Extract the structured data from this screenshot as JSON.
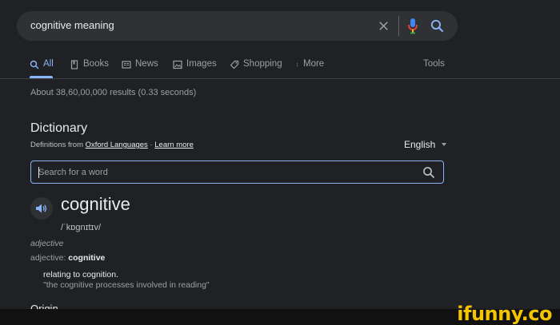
{
  "search": {
    "query": "cognitive meaning"
  },
  "tabs": [
    {
      "label": "All",
      "icon": "search-icon"
    },
    {
      "label": "Books",
      "icon": "book-icon"
    },
    {
      "label": "News",
      "icon": "news-icon"
    },
    {
      "label": "Images",
      "icon": "image-icon"
    },
    {
      "label": "Shopping",
      "icon": "tag-icon"
    },
    {
      "label": "More",
      "icon": "kebab-icon"
    }
  ],
  "tools_label": "Tools",
  "result_stats": "About 38,60,00,000 results (0.33 seconds)",
  "dictionary": {
    "title": "Dictionary",
    "defs_from_prefix": "Definitions from",
    "source": "Oxford Languages",
    "separator": "·",
    "learn_more": "Learn more",
    "language": "English",
    "search_placeholder": "Search for a word",
    "word": "cognitive",
    "phonetic": "/ˈkɒɡnɪtɪv/",
    "part_of_speech": "adjective",
    "pos_label": "adjective:",
    "pos_word": "cognitive",
    "definition": "relating to cognition.",
    "example": "\"the cognitive processes involved in reading\"",
    "origin_heading": "Origin"
  },
  "watermark": "ifunny.co",
  "colors": {
    "accent": "#8ab4f8",
    "background": "#202124",
    "watermark": "#f5c400"
  }
}
